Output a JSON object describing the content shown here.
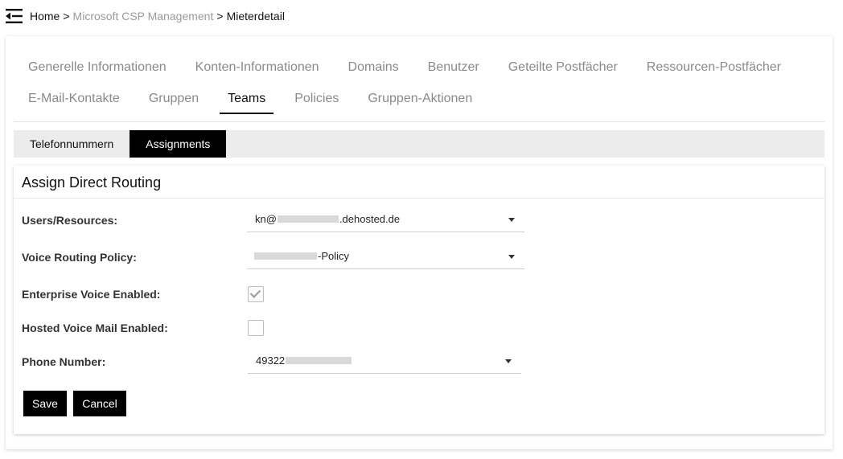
{
  "header": {
    "menu_icon": "menu-collapse-icon",
    "breadcrumb": {
      "home": "Home",
      "separator": ">",
      "section": "Microsoft CSP Management",
      "current": "Mieterdetail"
    }
  },
  "tabs": {
    "row1": [
      "Generelle Informationen",
      "Konten-Informationen",
      "Domains",
      "Benutzer",
      "Geteilte Postfächer",
      "Ressourcen-Postfächer"
    ],
    "row2": [
      "E-Mail-Kontakte",
      "Gruppen",
      "Teams",
      "Policies",
      "Gruppen-Aktionen"
    ],
    "active": "Teams"
  },
  "subtabs": {
    "items": [
      "Telefonnummern",
      "Assignments"
    ],
    "active": "Assignments"
  },
  "form": {
    "title": "Assign Direct Routing",
    "users": {
      "label": "Users/Resources:",
      "value_prefix": "kn@",
      "value_suffix": ".dehosted.de"
    },
    "voice_routing": {
      "label": "Voice Routing Policy:",
      "value_suffix": "-Policy"
    },
    "enterprise_voice": {
      "label": "Enterprise Voice Enabled:",
      "checked": true
    },
    "hosted_voicemail": {
      "label": "Hosted Voice Mail Enabled:",
      "checked": false
    },
    "phone_number": {
      "label": "Phone Number:",
      "value_prefix": "49322"
    },
    "save_label": "Save",
    "cancel_label": "Cancel"
  },
  "colors": {
    "accent": "#000000",
    "muted_text": "#8a8a8a",
    "subtab_bar": "#ececec"
  }
}
